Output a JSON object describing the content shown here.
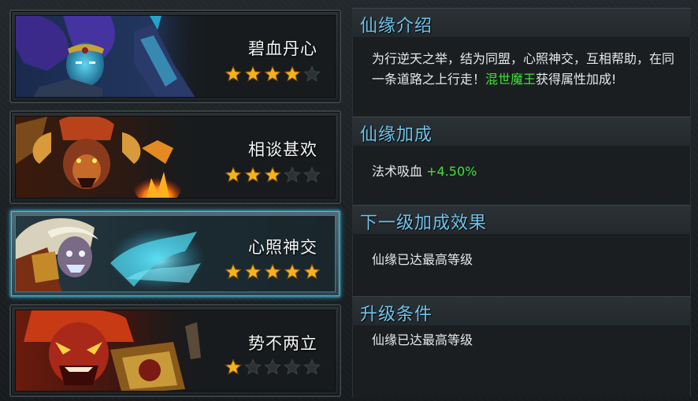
{
  "colors": {
    "section_title": "#6ec2ea",
    "highlight": "#3ee23a",
    "text": "#e8e8e8",
    "star_on": "#f4b21c",
    "star_off": "#2c3134"
  },
  "cards": [
    {
      "name": "碧血丹心",
      "stars": 4,
      "max_stars": 5,
      "selected": false,
      "portrait": "blue-warrior-portrait"
    },
    {
      "name": "相谈甚欢",
      "stars": 3,
      "max_stars": 5,
      "selected": false,
      "portrait": "flame-demon-portrait"
    },
    {
      "name": "心照神交",
      "stars": 5,
      "max_stars": 5,
      "selected": true,
      "portrait": "white-haired-beast-portrait"
    },
    {
      "name": "势不两立",
      "stars": 1,
      "max_stars": 5,
      "selected": false,
      "portrait": "red-demon-king-portrait"
    }
  ],
  "intro": {
    "title": "仙缘介绍",
    "text_before": "为行逆天之举，结为同盟，心照神交，互相帮助，在同一条道路之上行走！",
    "highlight": "混世魔王",
    "text_after": "获得属性加成!"
  },
  "bonus": {
    "title": "仙缘加成",
    "stat_label": "法术吸血",
    "stat_value": "+4.50%"
  },
  "next_level": {
    "title": "下一级加成效果",
    "text": "仙缘已达最高等级"
  },
  "upgrade": {
    "title": "升级条件",
    "text": "仙缘已达最高等级"
  }
}
